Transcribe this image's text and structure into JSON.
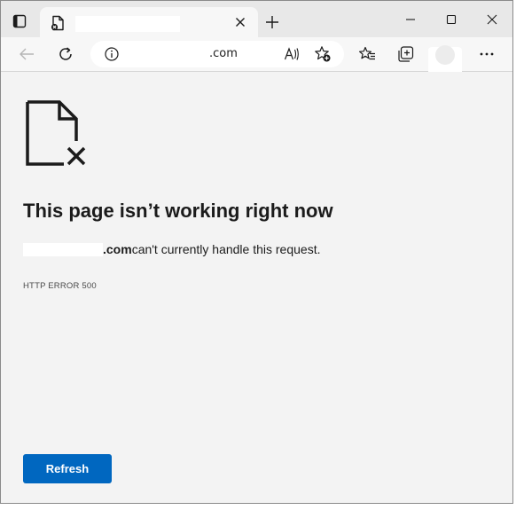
{
  "browser": {
    "tab": {
      "title": ""
    },
    "address_bar": {
      "host": "",
      "url_suffix": ".com"
    }
  },
  "page": {
    "title": "This page isn’t working right now",
    "description": {
      "host": "",
      "domain_suffix": ".com",
      "message": " can't currently handle this request."
    },
    "error_code": "HTTP ERROR 500",
    "refresh_label": "Refresh"
  },
  "colors": {
    "accent": "#0067c0",
    "page_background": "#f3f3f3",
    "tab_strip": "#e8e8e8"
  },
  "icons": {
    "tab_actions": "tab-actions-icon",
    "favicon": "broken-page-icon",
    "close": "close-icon",
    "new_tab": "plus-icon",
    "back": "back-arrow-icon",
    "refresh": "refresh-icon",
    "info": "info-icon",
    "read_aloud": "read-aloud-icon",
    "add_favorite": "star-add-icon",
    "favorites": "favorites-list-icon",
    "collections": "collections-icon",
    "more": "more-dots-icon",
    "error": "broken-document-icon"
  }
}
